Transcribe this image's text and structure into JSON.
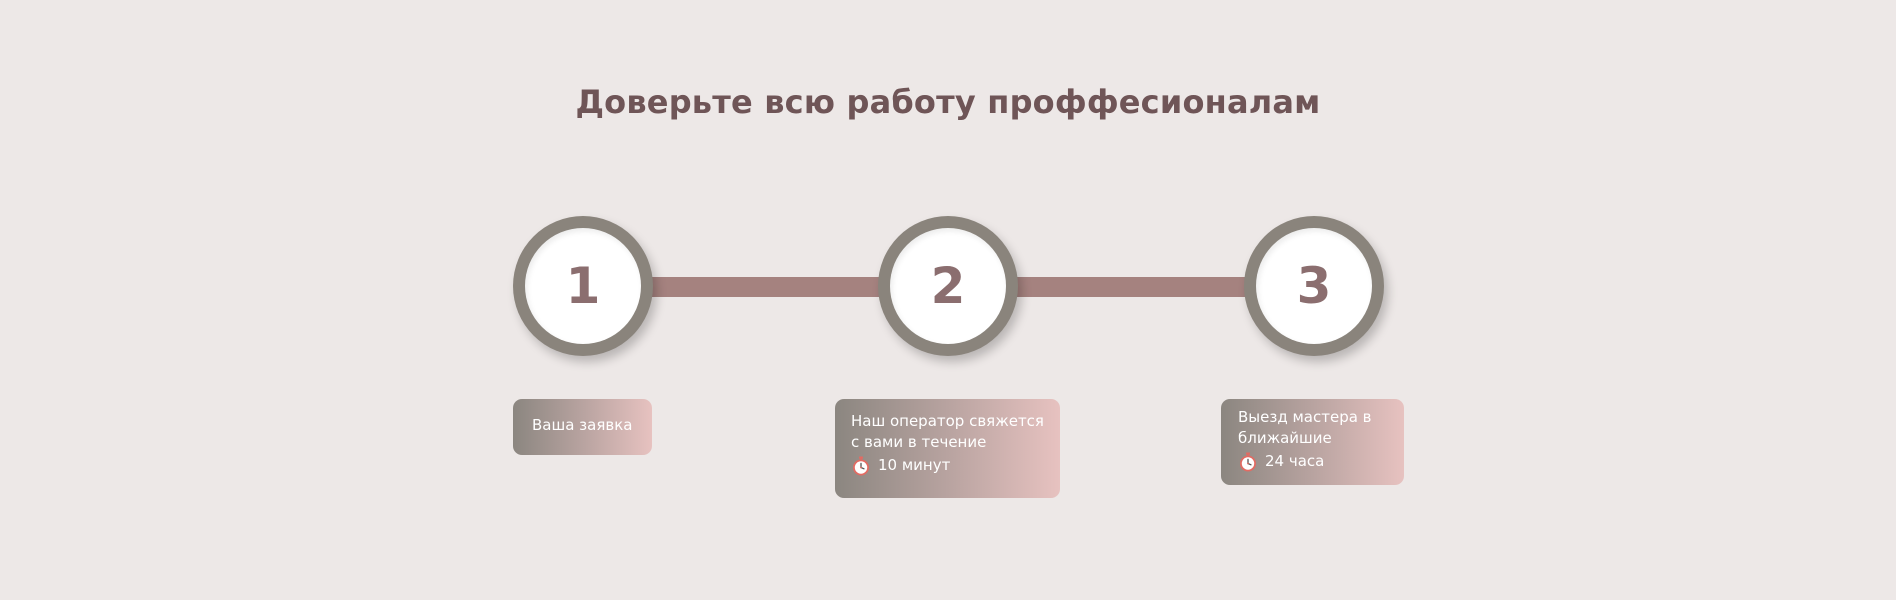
{
  "title": "Доверьте всю работу проффесионалам",
  "colors": {
    "background": "#ede8e7",
    "title": "#6f5557",
    "connector": "#a5827f",
    "circle_ring": "#8a847c",
    "step_number": "#8b6e6f",
    "card_gradient_start": "#8b8680",
    "card_gradient_end": "#e7c2c0"
  },
  "steps": [
    {
      "number": "1",
      "text": "Ваша заявка"
    },
    {
      "number": "2",
      "text": "Наш оператор свяжется с вами в течение",
      "icon": "stopwatch-icon",
      "time": "10 минут"
    },
    {
      "number": "3",
      "text": "Выезд мастера в ближайшие",
      "icon": "stopwatch-icon",
      "time": "24 часа"
    }
  ]
}
